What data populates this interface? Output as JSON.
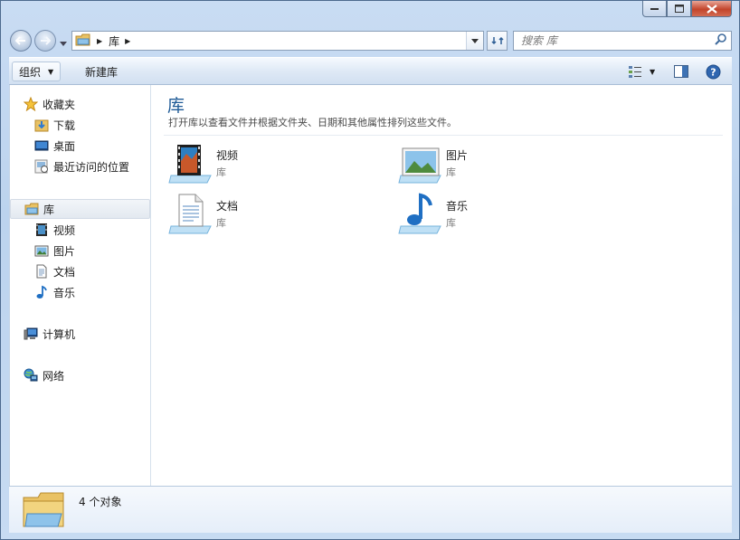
{
  "address": {
    "crumb": "库",
    "crumb_arrow": "▶"
  },
  "search": {
    "placeholder": "搜索 库"
  },
  "toolbar": {
    "organize_label": "组织",
    "new_library_label": "新建库",
    "caret": "▼"
  },
  "nav": {
    "favorites": {
      "header": "收藏夹",
      "items": [
        {
          "label": "下载"
        },
        {
          "label": "桌面"
        },
        {
          "label": "最近访问的位置"
        }
      ]
    },
    "libraries": {
      "header": "库",
      "items": [
        {
          "label": "视频"
        },
        {
          "label": "图片"
        },
        {
          "label": "文档"
        },
        {
          "label": "音乐"
        }
      ]
    },
    "computer": {
      "label": "计算机"
    },
    "network": {
      "label": "网络"
    }
  },
  "main": {
    "title": "库",
    "subtitle": "打开库以查看文件并根据文件夹、日期和其他属性排列这些文件。",
    "libraries": [
      {
        "name": "视频",
        "type": "库",
        "icon": "video-library-icon"
      },
      {
        "name": "图片",
        "type": "库",
        "icon": "pictures-library-icon"
      },
      {
        "name": "文档",
        "type": "库",
        "icon": "documents-library-icon"
      },
      {
        "name": "音乐",
        "type": "库",
        "icon": "music-library-icon"
      }
    ]
  },
  "details": {
    "count_text": "4 个对象"
  },
  "colors": {
    "accent_title": "#1e5a96",
    "close_button": "#c2442b",
    "window_frame": "#c9dcf3"
  }
}
